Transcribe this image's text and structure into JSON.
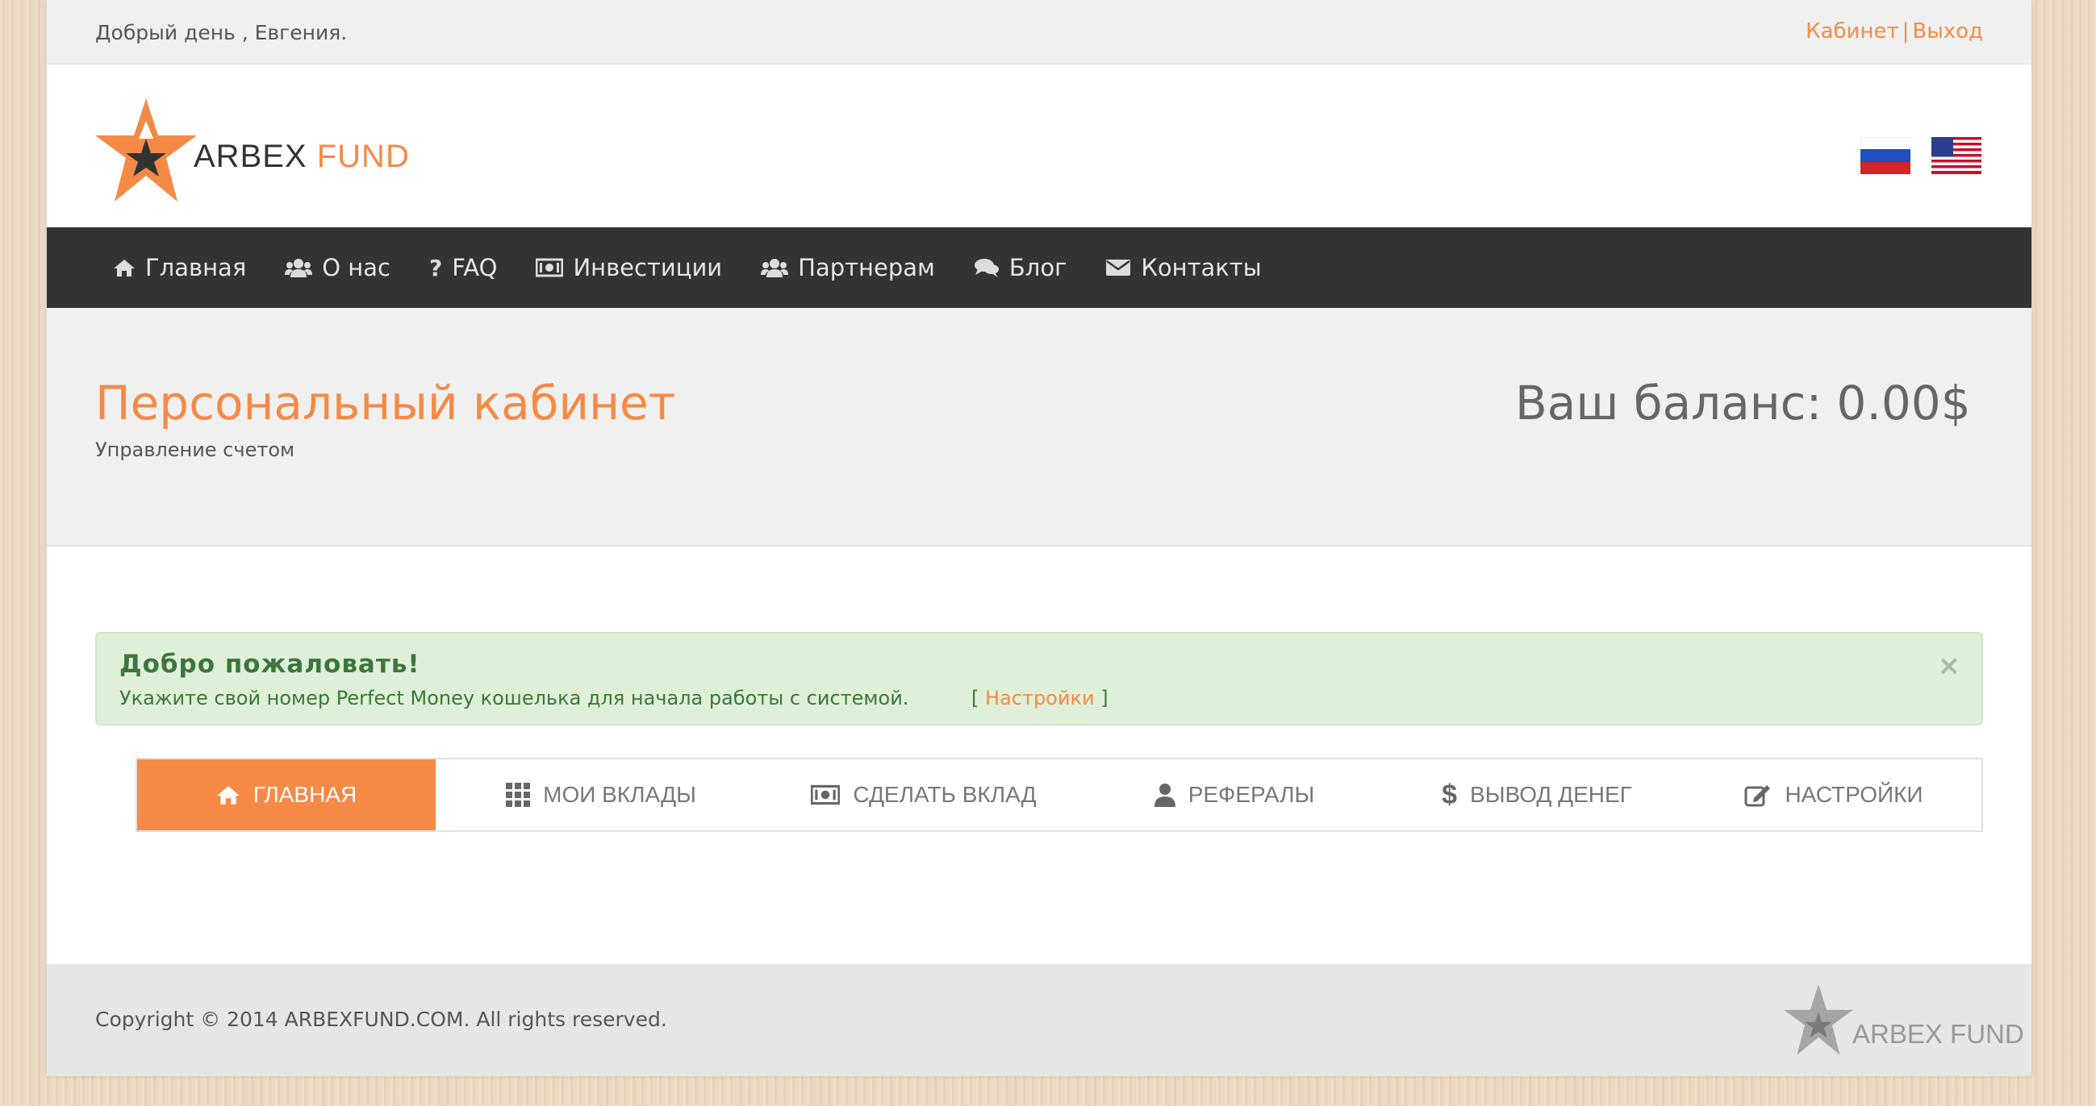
{
  "topbar": {
    "greeting": "Добрый день , Евгения.",
    "cabinet_link": "Кабинет",
    "separator": "|",
    "logout_link": "Выход"
  },
  "header": {
    "logo_word1": "ARBEX",
    "logo_word2": "FUND",
    "languages": [
      "ru-flag-icon",
      "us-flag-icon"
    ]
  },
  "nav": {
    "items": [
      {
        "label": "Главная",
        "icon": "home-icon"
      },
      {
        "label": "О нас",
        "icon": "users-icon"
      },
      {
        "label": "FAQ",
        "icon": "question-icon"
      },
      {
        "label": "Инвестиции",
        "icon": "money-icon"
      },
      {
        "label": "Партнерам",
        "icon": "users-icon"
      },
      {
        "label": "Блог",
        "icon": "comments-icon"
      },
      {
        "label": "Контакты",
        "icon": "envelope-icon"
      }
    ]
  },
  "pagehead": {
    "title": "Персональный кабинет",
    "subtitle": "Управление счетом",
    "balance": "Ваш баланс: 0.00$"
  },
  "alert": {
    "title": "Добро пожаловать!",
    "text": "Укажите свой номер Perfect Money кошелька для начала работы с системой.",
    "link_open": "[",
    "link_label": "Настройки",
    "link_close": "]",
    "close": "×"
  },
  "tabs": [
    {
      "label": "ГЛАВНАЯ",
      "icon": "home-icon",
      "active": true
    },
    {
      "label": "МОИ ВКЛАДЫ",
      "icon": "grid-icon",
      "active": false
    },
    {
      "label": "СДЕЛАТЬ ВКЛАД",
      "icon": "money-icon",
      "active": false
    },
    {
      "label": "РЕФЕРАЛЫ",
      "icon": "user-icon",
      "active": false
    },
    {
      "label": "ВЫВОД ДЕНЕГ",
      "icon": "dollar-icon",
      "active": false
    },
    {
      "label": "НАСТРОЙКИ",
      "icon": "edit-icon",
      "active": false
    }
  ],
  "footer": {
    "copyright": "Copyright © 2014 ARBEXFUND.COM. All rights reserved.",
    "logo_text": "ARBEX FUND"
  },
  "colors": {
    "accent": "#f58a46",
    "nav_bg": "#333333",
    "alert_bg": "#dff0d8",
    "alert_text": "#3c763d"
  }
}
